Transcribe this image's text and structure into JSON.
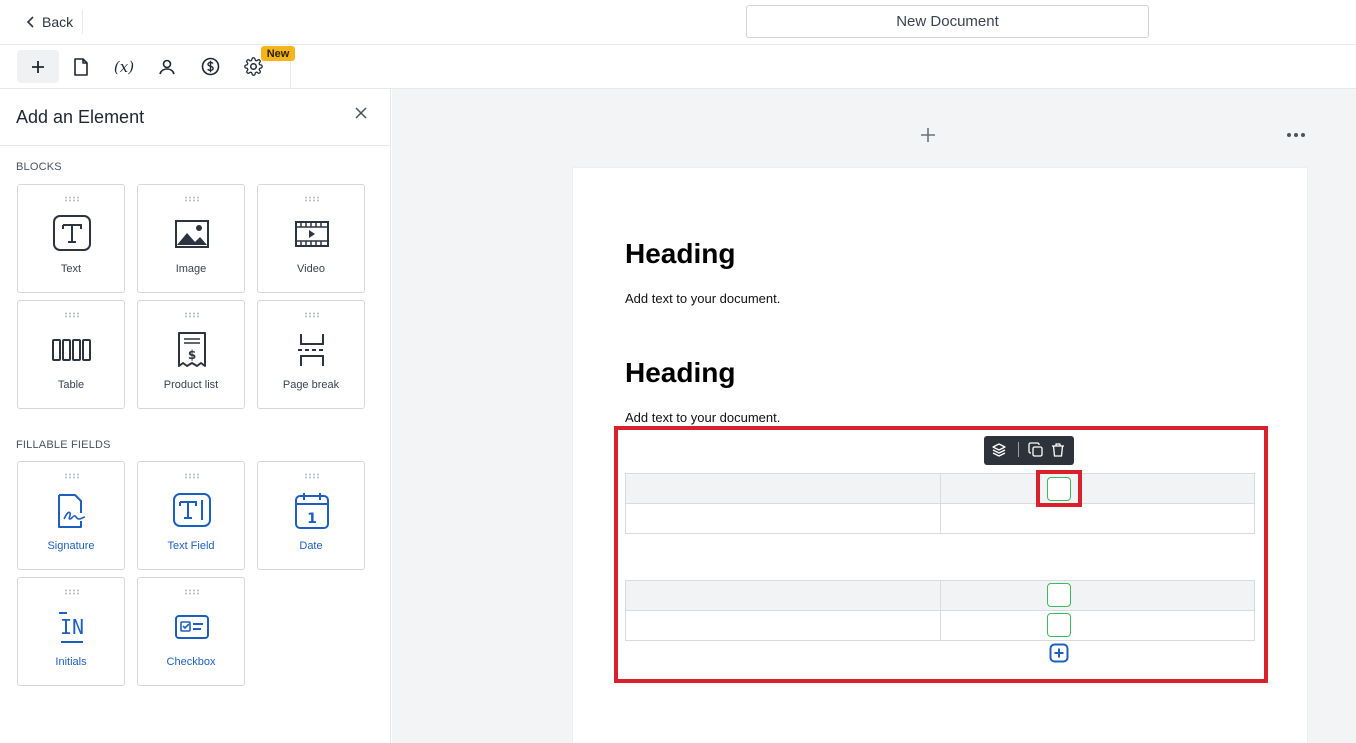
{
  "header": {
    "back_label": "Back",
    "document_title": "New Document"
  },
  "toolbar": {
    "buttons": [
      "add-icon",
      "page-icon",
      "variable-icon",
      "user-icon",
      "dollar-icon",
      "gear-icon"
    ],
    "variable_label": "(x)",
    "new_badge": "New"
  },
  "sidebar": {
    "title": "Add an Element",
    "sections": {
      "blocks": "BLOCKS",
      "fillable": "FILLABLE FIELDS"
    },
    "blocks": [
      {
        "label": "Text",
        "icon": "text-block-icon"
      },
      {
        "label": "Image",
        "icon": "image-icon"
      },
      {
        "label": "Video",
        "icon": "video-icon"
      },
      {
        "label": "Table",
        "icon": "table-icon"
      },
      {
        "label": "Product list",
        "icon": "product-list-icon"
      },
      {
        "label": "Page break",
        "icon": "page-break-icon"
      }
    ],
    "fields": [
      {
        "label": "Signature",
        "icon": "signature-icon"
      },
      {
        "label": "Text Field",
        "icon": "text-field-icon"
      },
      {
        "label": "Date",
        "icon": "date-icon"
      },
      {
        "label": "Initials",
        "icon": "initials-icon"
      },
      {
        "label": "Checkbox",
        "icon": "checkbox-icon"
      }
    ],
    "date_icon_number": "1",
    "initials_icon_text": "IN"
  },
  "document": {
    "blocks": [
      {
        "heading": "Heading",
        "text": "Add text to your document."
      },
      {
        "heading": "Heading",
        "text": "Add text to your document."
      }
    ]
  },
  "colors": {
    "accent_blue": "#1d5fc0",
    "checkbox_green": "#3bbb5f",
    "highlight_red": "#d9212b",
    "badge_yellow": "#f5b41c"
  }
}
